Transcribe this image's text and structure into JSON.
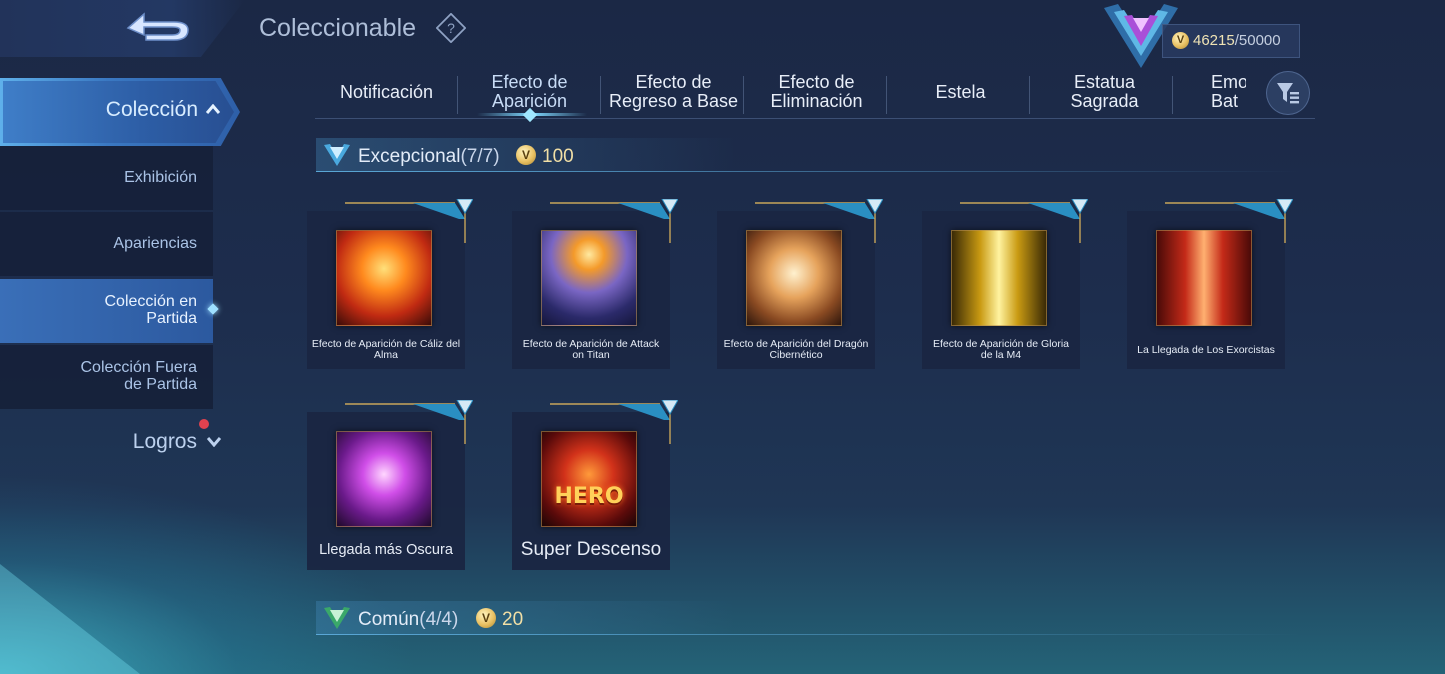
{
  "header": {
    "title": "Coleccionable",
    "currency": {
      "current": "46215",
      "max": "/50000",
      "coin_icon": "coin-icon"
    }
  },
  "sidebar": {
    "main": {
      "label": "Colección"
    },
    "items": [
      {
        "label": "Exhibición"
      },
      {
        "label": "Apariencias"
      },
      {
        "label": "Colección en\nPartida",
        "active": true
      },
      {
        "label": "Colección Fuera\nde Partida"
      }
    ],
    "logros": {
      "label": "Logros"
    }
  },
  "tabs": [
    {
      "label": "Notificación"
    },
    {
      "label": "Efecto de\nAparición",
      "active": true
    },
    {
      "label": "Efecto de\nRegreso a Base"
    },
    {
      "label": "Efecto de\nEliminación"
    },
    {
      "label": "Estela"
    },
    {
      "label": "Estatua\nSagrada"
    },
    {
      "label": "Emo\nBat"
    }
  ],
  "sections": [
    {
      "title": "Excepcional",
      "count": "(7/7)",
      "cost": "100"
    },
    {
      "title": "Común",
      "count": "(4/4)",
      "cost": "20"
    }
  ],
  "cards": [
    {
      "name": "Efecto de Aparición de Cáliz del Alma"
    },
    {
      "name": "Efecto de Aparición de Attack on Titan"
    },
    {
      "name": "Efecto de Aparición del Dragón Cibernético"
    },
    {
      "name": "Efecto de Aparición de Gloria de la M4"
    },
    {
      "name": "La Llegada de Los Exorcistas"
    },
    {
      "name": "Llegada más Oscura"
    },
    {
      "name": "Super Descenso"
    }
  ],
  "card_overlay_text": {
    "hero": "HERO"
  },
  "colors": {
    "accent": "#7fd8ff",
    "gold": "#f1dfa6",
    "badge": "#e0424f"
  }
}
